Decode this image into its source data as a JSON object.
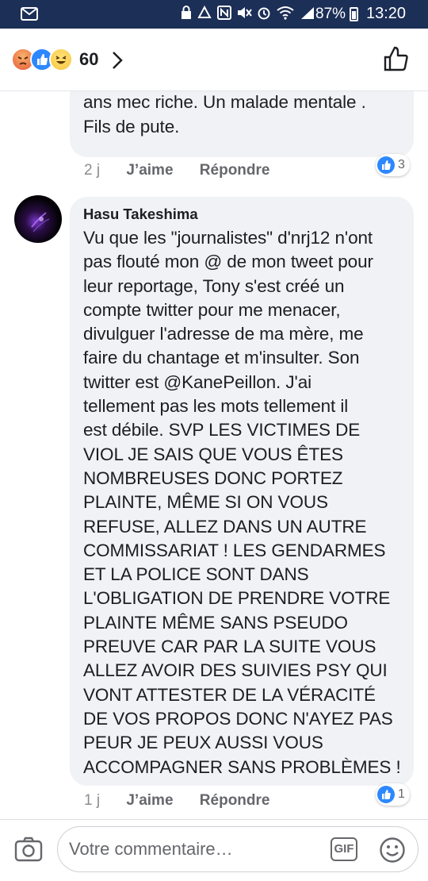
{
  "status_bar": {
    "battery": "87%",
    "time": "13:20"
  },
  "header": {
    "reaction_count": "60",
    "reactions": [
      "angry",
      "like",
      "haha"
    ]
  },
  "comments": [
    {
      "text": "Tomm rb avec des métiers sois l dix\nans mec riche. Un malade mentale .\nFils de pute.",
      "age": "2 j",
      "like_label": "J’aime",
      "reply_label": "Répondre",
      "reaction_count": "3"
    },
    {
      "author": "Hasu Takeshima",
      "text": "Vu que les \"journalistes\" d'nrj12 n'ont\npas flouté mon @ de mon tweet pour\nleur reportage, Tony s'est créé un\ncompte twitter pour me menacer,\ndivulguer l'adresse de ma mère, me\nfaire du chantage et m'insulter. Son\ntwitter est @KanePeillon. J'ai\ntellement pas les mots tellement il\nest débile. SVP LES VICTIMES DE\nVIOL JE SAIS QUE VOUS ÊTES\nNOMBREUSES DONC PORTEZ\nPLAINTE, MÊME SI ON VOUS\nREFUSE, ALLEZ DANS UN AUTRE\nCOMMISSARIAT ! LES GENDARMES\nET LA POLICE SONT DANS\nL'OBLIGATION DE PRENDRE VOTRE\nPLAINTE MÊME SANS PSEUDO\nPREUVE CAR PAR LA SUITE VOUS\nALLEZ AVOIR DES SUIVIES PSY QUI\nVONT ATTESTER DE LA VÉRACITÉ\nDE VOS PROPOS DONC N'AYEZ PAS\nPEUR JE PEUX AUSSI VOUS\nACCOMPAGNER SANS PROBLÈMES !",
      "age": "1 j",
      "like_label": "J’aime",
      "reply_label": "Répondre",
      "reaction_count": "1"
    }
  ],
  "composer": {
    "placeholder": "Votre commentaire…",
    "gif_label": "GIF"
  },
  "colors": {
    "status_bar": "#1c2f57",
    "bubble": "#f0f2f5",
    "like_blue": "#2d88ff"
  }
}
